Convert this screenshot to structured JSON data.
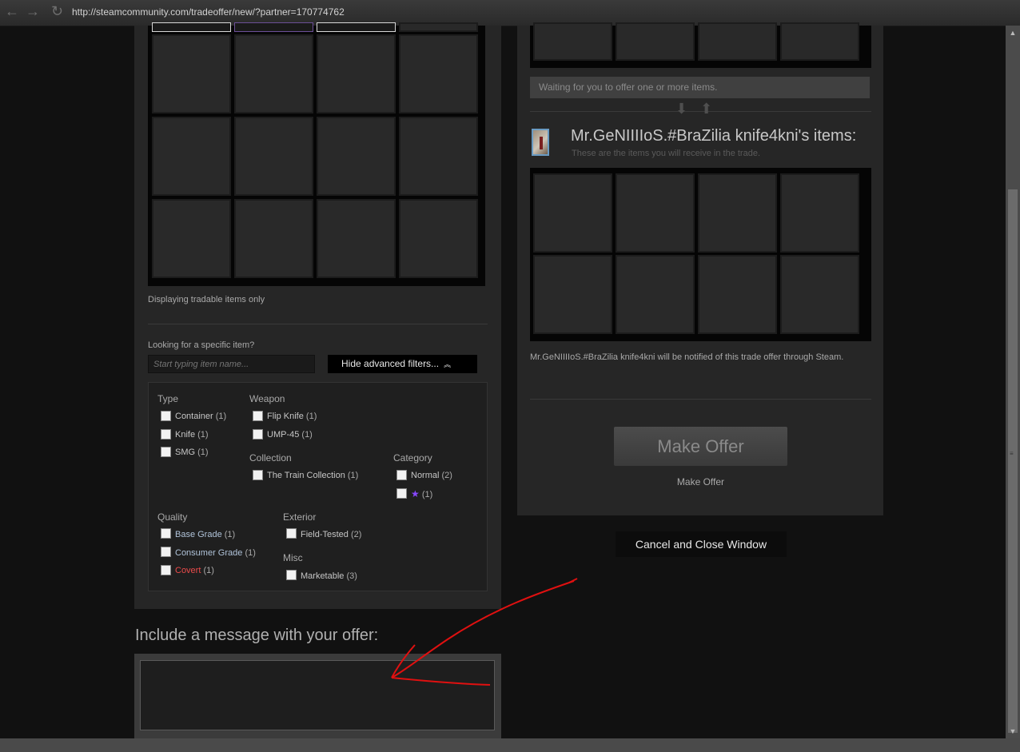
{
  "browser": {
    "url": "http://steamcommunity.com/tradeoffer/new/?partner=170774762"
  },
  "inventory": {
    "note": "Displaying tradable items only",
    "search_label": "Looking for a specific item?",
    "search_placeholder": "Start typing item name...",
    "filters_button": "Hide advanced filters..."
  },
  "filters": {
    "type": {
      "heading": "Type",
      "options": [
        {
          "label": "Container",
          "count": "(1)"
        },
        {
          "label": "Knife",
          "count": "(1)"
        },
        {
          "label": "SMG",
          "count": "(1)"
        }
      ]
    },
    "weapon": {
      "heading": "Weapon",
      "options": [
        {
          "label": "Flip Knife",
          "count": "(1)"
        },
        {
          "label": "UMP-45",
          "count": "(1)"
        }
      ]
    },
    "collection": {
      "heading": "Collection",
      "options": [
        {
          "label": "The Train Collection",
          "count": "(1)"
        }
      ]
    },
    "category": {
      "heading": "Category",
      "options": [
        {
          "label": "Normal",
          "count": "(2)"
        },
        {
          "label": "★",
          "count": "(1)"
        }
      ]
    },
    "quality": {
      "heading": "Quality",
      "options": [
        {
          "label": "Base Grade",
          "count": "(1)"
        },
        {
          "label": "Consumer Grade",
          "count": "(1)"
        },
        {
          "label": "Covert",
          "count": "(1)"
        }
      ]
    },
    "exterior": {
      "heading": "Exterior",
      "options": [
        {
          "label": "Field-Tested",
          "count": "(2)"
        }
      ]
    },
    "misc": {
      "heading": "Misc",
      "options": [
        {
          "label": "Marketable",
          "count": "(3)"
        }
      ]
    }
  },
  "message": {
    "title": "Include a message with your offer:"
  },
  "trade": {
    "waiting_text": "Waiting for you to offer one or more items.",
    "their_items_title": "Mr.GeNIIIIoS.#BraZilia knife4kni's items:",
    "their_items_subtitle": "These are the items you will receive in the trade.",
    "notify_text": "Mr.GeNIIIIoS.#BraZilia knife4kni will be notified of this trade offer through Steam.",
    "make_offer_button": "Make Offer",
    "make_offer_label": "Make Offer",
    "cancel_button": "Cancel and Close Window"
  },
  "colors": {
    "background": "#111111",
    "panel": "#262626",
    "covert": "#eb4b4b",
    "star": "#8847ff",
    "annotation": "#e01010"
  },
  "icons": {
    "back": "arrow-left-icon",
    "forward": "arrow-right-icon",
    "reload": "reload-icon",
    "expand": "chevron-up-double-icon",
    "swap": "swap-arrows-icon"
  }
}
